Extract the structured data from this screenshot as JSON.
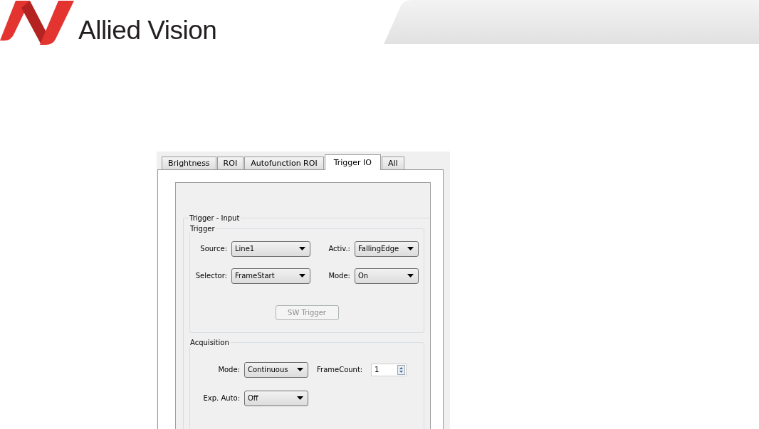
{
  "header": {
    "brand": "Allied Vision"
  },
  "tabs": [
    {
      "label": "Brightness",
      "selected": false
    },
    {
      "label": "ROI",
      "selected": false
    },
    {
      "label": "Autofunction ROI",
      "selected": false
    },
    {
      "label": "Trigger IO",
      "selected": true
    },
    {
      "label": "All",
      "selected": false
    }
  ],
  "section_title": "Trigger - Input",
  "trigger_group": {
    "title": "Trigger",
    "fields": [
      {
        "label": "Source:",
        "value": "Line1",
        "kind": "dropdown"
      },
      {
        "label": "Activ.:",
        "value": "FallingEdge",
        "kind": "dropdown"
      },
      {
        "label": "Selector:",
        "value": "FrameStart",
        "kind": "dropdown"
      },
      {
        "label": "Mode:",
        "value": "On",
        "kind": "dropdown"
      }
    ],
    "button": {
      "label": "SW Trigger",
      "disabled": true
    }
  },
  "acquisition_group": {
    "title": "Acquisition",
    "fields": [
      {
        "label": "Mode:",
        "value": "Continuous",
        "kind": "dropdown"
      },
      {
        "label": "FrameCount:",
        "value": "1",
        "kind": "spinner"
      },
      {
        "label": "Exp. Auto:",
        "value": "Off",
        "kind": "dropdown"
      }
    ]
  }
}
